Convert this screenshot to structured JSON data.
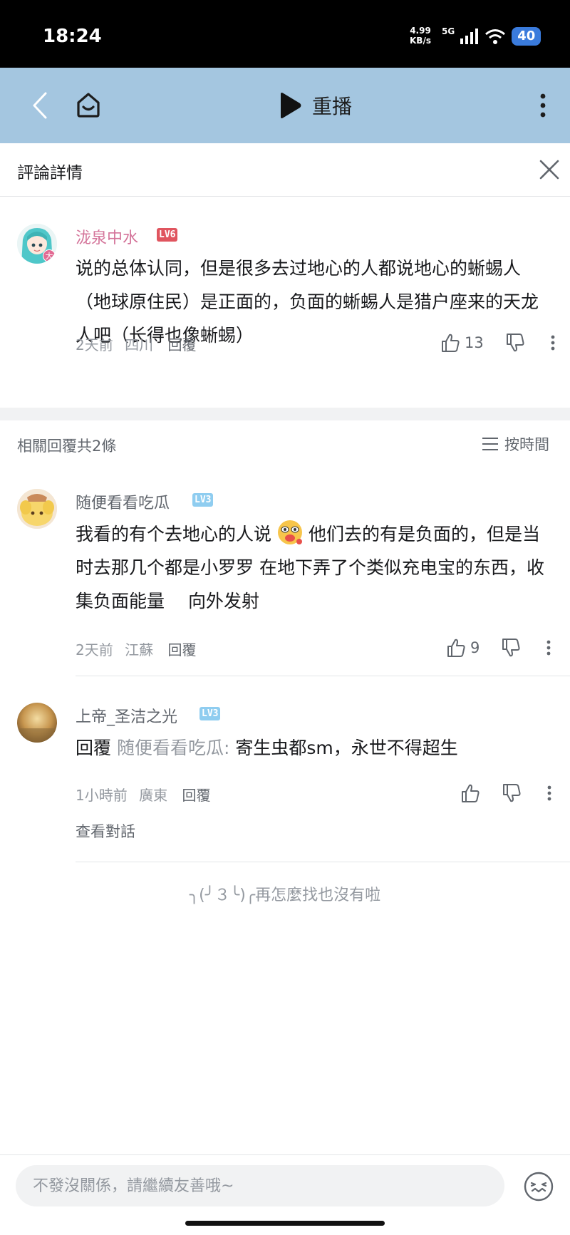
{
  "status_bar": {
    "time": "18:24",
    "net_speed": "4.99",
    "net_unit": "KB/s",
    "network": "5G",
    "battery": "40"
  },
  "nav": {
    "replay_label": "重播"
  },
  "sheet": {
    "title": "評論詳情"
  },
  "main_comment": {
    "user": "泷泉中水",
    "level": "LV6",
    "avatar_badge": "大",
    "text": "说的总体认同，但是很多去过地心的人都说地心的蜥蜴人（地球原住民）是正面的，负面的蜥蜴人是猎户座来的天龙人吧（长得也像蜥蜴）",
    "time": "2天前",
    "location": "四川",
    "reply_label": "回覆",
    "likes": "13"
  },
  "replies_bar": {
    "count_label": "相關回覆共2條",
    "sort_label": "按時間"
  },
  "replies": [
    {
      "user": "随便看看吃瓜",
      "level": "LV3",
      "text_before_emoji": "我看的有个去地心的人说",
      "text_after_emoji": "他们去的有是负面的，但是当时去那几个都是小罗罗 在地下弄了个类似充电宝的东西，收集负面能量　 向外发射",
      "time": "2天前",
      "location": "江蘇",
      "reply_label": "回覆",
      "likes": "9"
    },
    {
      "user": "上帝_圣洁之光",
      "level": "LV3",
      "reply_prefix": "回覆",
      "reply_target": "随便看看吃瓜:",
      "text": "寄生虫都sm，永世不得超生",
      "time": "1小時前",
      "location": "廣東",
      "reply_label": "回覆",
      "view_conversation": "查看對話"
    }
  ],
  "end_note": "╮(╯３╰)╭再怎麼找也沒有啦",
  "input": {
    "placeholder": "不發沒關係，請繼續友善哦~"
  },
  "colors": {
    "nav_bg": "#a4c6e0",
    "vip_name": "#d4749a",
    "lv6": "#e0555f",
    "lv3": "#8fcdf0"
  }
}
